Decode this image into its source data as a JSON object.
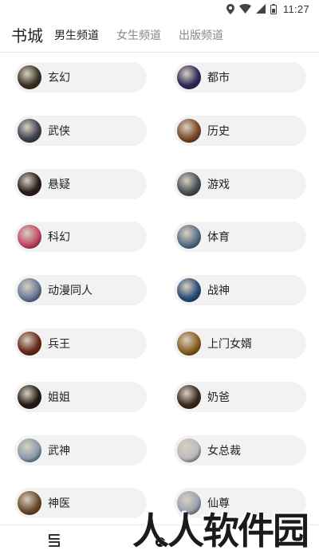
{
  "status_bar": {
    "time": "11:27",
    "icons": [
      "location-icon",
      "wifi-icon",
      "signal-icon",
      "battery-icon"
    ]
  },
  "header": {
    "title": "书城",
    "tabs": [
      {
        "label": "男生频道",
        "active": true
      },
      {
        "label": "女生频道",
        "active": false
      },
      {
        "label": "出版频道",
        "active": false
      }
    ]
  },
  "categories": [
    {
      "label": "玄幻",
      "color": "#3a3326"
    },
    {
      "label": "都市",
      "color": "#2f2a5c"
    },
    {
      "label": "武侠",
      "color": "#3e4450"
    },
    {
      "label": "历史",
      "color": "#7a4a2a"
    },
    {
      "label": "悬疑",
      "color": "#2a1e1a"
    },
    {
      "label": "游戏",
      "color": "#4a5058"
    },
    {
      "label": "科幻",
      "color": "#c44a6a"
    },
    {
      "label": "体育",
      "color": "#5a7088"
    },
    {
      "label": "动漫同人",
      "color": "#6a7a9a"
    },
    {
      "label": "战神",
      "color": "#2a4e7a"
    },
    {
      "label": "兵王",
      "color": "#6a2a1a"
    },
    {
      "label": "上门女婿",
      "color": "#8a6020"
    },
    {
      "label": "姐姐",
      "color": "#241a18"
    },
    {
      "label": "奶爸",
      "color": "#3a2a20"
    },
    {
      "label": "武神",
      "color": "#8a9aaa"
    },
    {
      "label": "女总裁",
      "color": "#bbbbbb"
    },
    {
      "label": "神医",
      "color": "#6a4a2a"
    },
    {
      "label": "仙尊",
      "color": "#9aa4b4"
    }
  ],
  "watermark": "人人软件园",
  "bottom_nav": {
    "icons": [
      "bookshelf-icon",
      "discover-icon"
    ]
  }
}
